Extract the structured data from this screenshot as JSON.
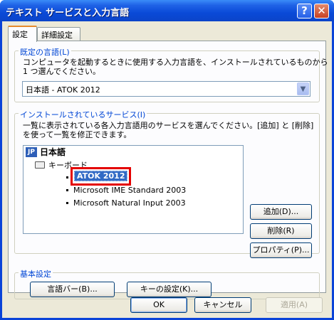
{
  "window": {
    "title": "テキスト サービスと入力言語",
    "help_button": "?",
    "close_button": "✕"
  },
  "tabs": [
    {
      "label": "設定",
      "active": true
    },
    {
      "label": "詳細設定",
      "active": false
    }
  ],
  "default_language": {
    "legend": "既定の言語(L)",
    "description_line1": "コンピュータを起動するときに使用する入力言語を、インストールされているものから",
    "description_line2": "1 つ選んでください。",
    "selected_value": "日本語 - ATOK 2012"
  },
  "installed_services": {
    "legend": "インストールされているサービス(I)",
    "description_line1": "一覧に表示されている各入力言語用のサービスを選んでください。[追加] と [削除]",
    "description_line2": "を使って一覧を修正できます。",
    "language_badge": "JP",
    "language_name": "日本語",
    "category": "キーボード",
    "items": [
      {
        "label": "ATOK 2012",
        "selected": true
      },
      {
        "label": "Microsoft IME Standard 2003",
        "selected": false
      },
      {
        "label": "Microsoft Natural Input 2003",
        "selected": false
      }
    ],
    "add_button": "追加(D)...",
    "remove_button": "削除(R)",
    "properties_button": "プロパティ(P)..."
  },
  "basic_settings": {
    "legend": "基本設定",
    "language_bar_button": "言語バー(B)...",
    "key_settings_button": "キーの設定(K)..."
  },
  "footer": {
    "ok_button": "OK",
    "cancel_button": "キャンセル",
    "apply_button": "適用(A)"
  },
  "colors": {
    "title_bar": "#0a4ad8",
    "selection": "#316ac5",
    "annotation_box": "#e40000",
    "legend_text": "#0046d5"
  }
}
